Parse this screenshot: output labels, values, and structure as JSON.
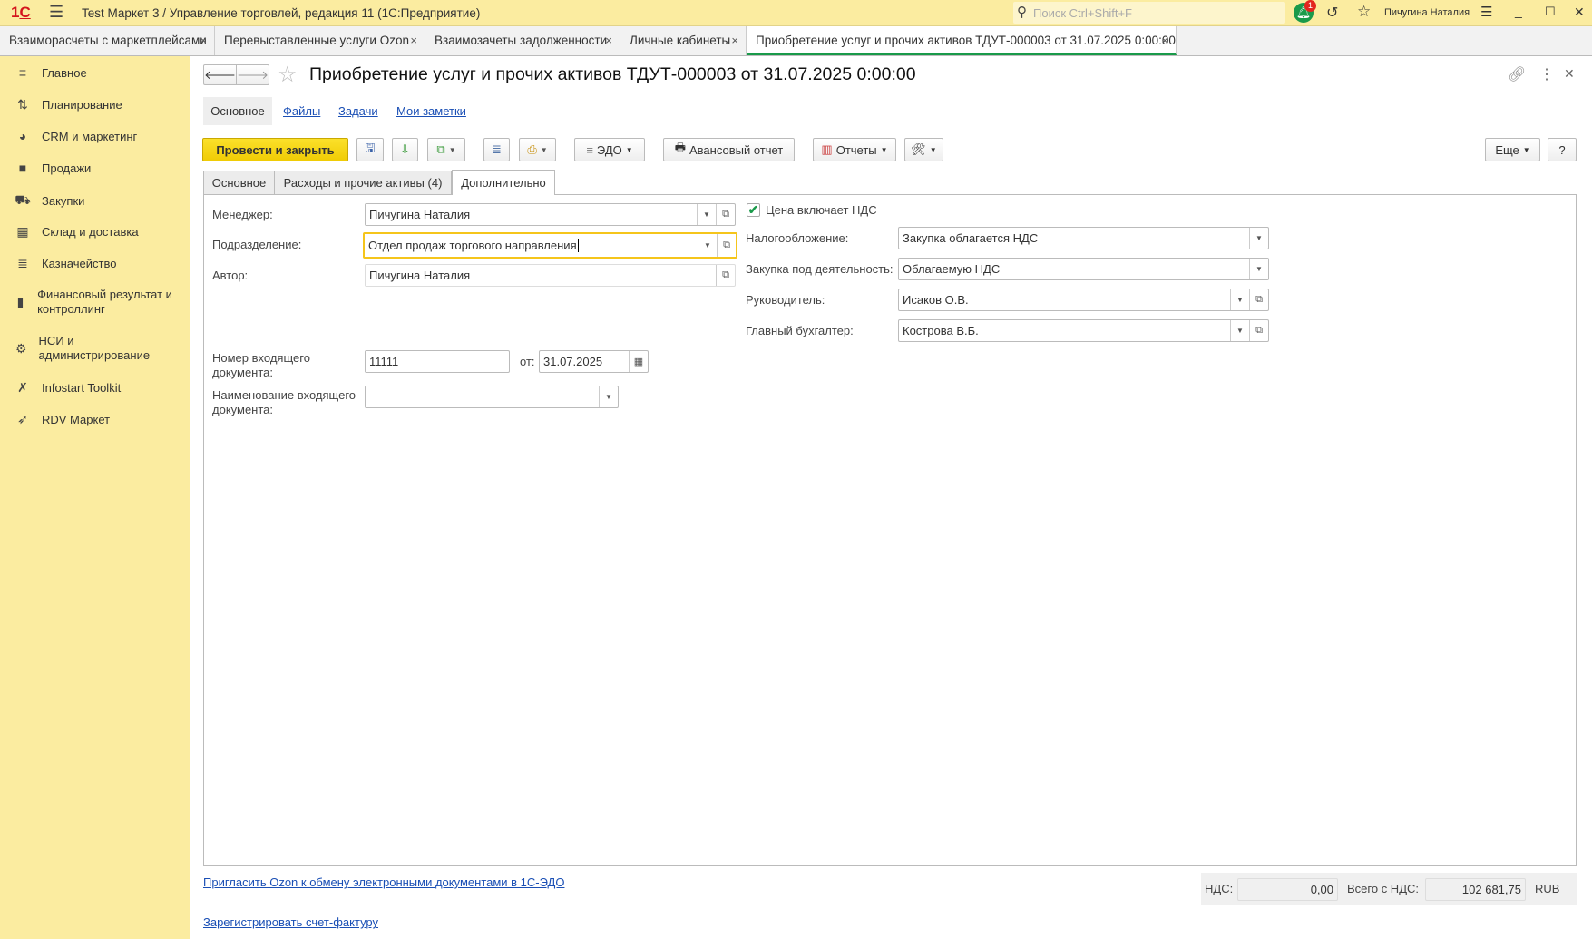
{
  "titlebar": {
    "logo": "1C",
    "title": "Test Маркет 3 / Управление торговлей, редакция 11  (1С:Предприятие)",
    "search_placeholder": "Поиск Ctrl+Shift+F",
    "notifications": "1",
    "user": "Пичугина Наталия"
  },
  "tabs": [
    {
      "label": "Взаиморасчеты с маркетплейсами"
    },
    {
      "label": "Перевыставленные услуги Ozon"
    },
    {
      "label": "Взаимозачеты задолженности"
    },
    {
      "label": "Личные кабинеты"
    },
    {
      "label": "Приобретение услуг и прочих активов ТДУТ-000003 от 31.07.2025 0:00:00",
      "active": true
    }
  ],
  "sidebar": {
    "items": [
      {
        "label": "Главное",
        "icon": "menu-icon"
      },
      {
        "label": "Планирование",
        "icon": "planning-icon"
      },
      {
        "label": "CRM и маркетинг",
        "icon": "pie-icon"
      },
      {
        "label": "Продажи",
        "icon": "bag-icon"
      },
      {
        "label": "Закупки",
        "icon": "cart-icon"
      },
      {
        "label": "Склад и доставка",
        "icon": "grid-icon"
      },
      {
        "label": "Казначейство",
        "icon": "coins-icon"
      },
      {
        "label": "Финансовый результат и контроллинг",
        "icon": "chart-icon"
      },
      {
        "label": "НСИ и администрирование",
        "icon": "gear-icon"
      },
      {
        "label": "Infostart Toolkit",
        "icon": "tools-icon"
      },
      {
        "label": "RDV Маркет",
        "icon": "rocket-icon"
      }
    ]
  },
  "document": {
    "title": "Приобретение услуг и прочих активов ТДУТ-000003 от 31.07.2025 0:00:00",
    "nav": [
      "Основное",
      "Файлы",
      "Задачи",
      "Мои заметки"
    ],
    "toolbar": {
      "post_close": "Провести и закрыть",
      "edo": "ЭДО",
      "advance_report": "Авансовый отчет",
      "reports": "Отчеты",
      "more": "Еще",
      "help": "?"
    },
    "form_tabs": [
      "Основное",
      "Расходы и прочие активы (4)",
      "Дополнительно"
    ],
    "fields": {
      "manager_label": "Менеджер:",
      "manager": "Пичугина Наталия",
      "department_label": "Подразделение:",
      "department": "Отдел продаж торгового направления",
      "author_label": "Автор:",
      "author": "Пичугина Наталия",
      "in_number_label": "Номер входящего документа:",
      "in_number": "11111",
      "from_label": "от:",
      "in_date": "31.07.2025",
      "in_name_label": "Наименование входящего документа:",
      "in_name": "",
      "price_incl_vat_label": "Цена включает НДС",
      "price_incl_vat": true,
      "taxation_label": "Налогообложение:",
      "taxation": "Закупка облагается НДС",
      "activity_label": "Закупка под деятельность:",
      "activity": "Облагаемую НДС",
      "head_label": "Руководитель:",
      "head": "Исаков О.В.",
      "accountant_label": "Главный бухгалтер:",
      "accountant": "Кострова В.Б."
    },
    "links": {
      "invite": "Пригласить Ozon к обмену электронными документами в 1С-ЭДО",
      "register_invoice": "Зарегистрировать счет-фактуру"
    },
    "totals": {
      "vat_label": "НДС:",
      "vat": "0,00",
      "total_label": "Всего с НДС:",
      "total": "102 681,75",
      "currency": "RUB"
    }
  },
  "colors": {
    "accent_yellow": "#fbeca0",
    "primary_button": "#f5d40f",
    "active_tab": "#1a9a4a",
    "link": "#1a4fb5"
  }
}
